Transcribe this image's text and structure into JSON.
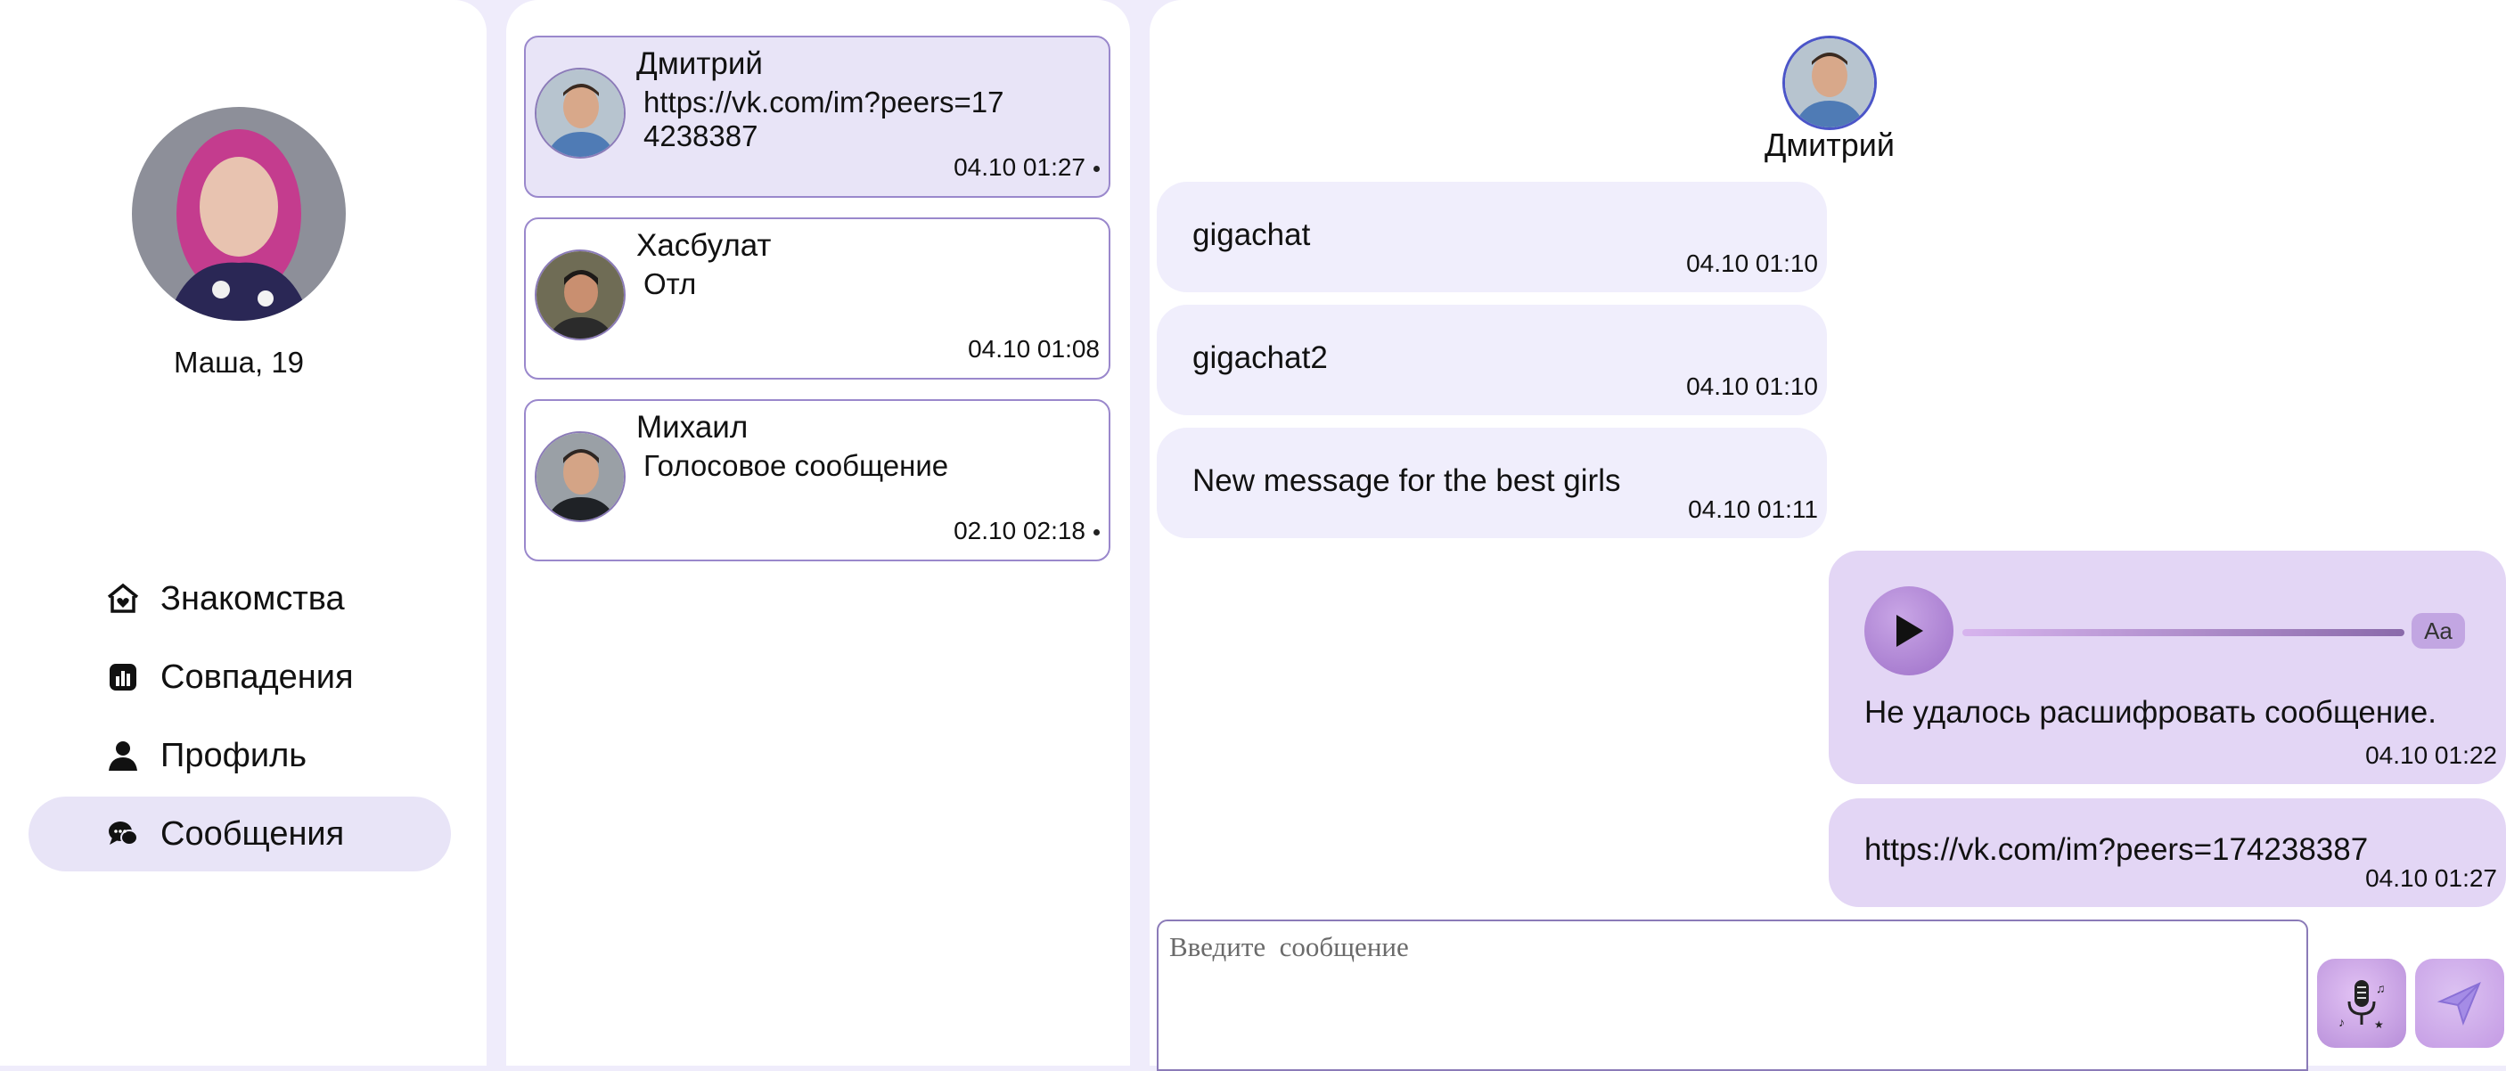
{
  "profile": {
    "name": "Маша, 19"
  },
  "nav": {
    "items": [
      {
        "label": "Знакомства",
        "icon": "home-heart-icon"
      },
      {
        "label": "Совпадения",
        "icon": "stats-icon"
      },
      {
        "label": "Профиль",
        "icon": "user-icon"
      },
      {
        "label": "Сообщения",
        "icon": "chat-icon",
        "active": true
      }
    ]
  },
  "conversations": [
    {
      "name": "Дмитрий",
      "text": "https://vk.com/im?peers=174238387",
      "time": "04.10 01:27",
      "unread": true,
      "active": true
    },
    {
      "name": "Хасбулат",
      "text": "Отл",
      "time": "04.10 01:08",
      "unread": false
    },
    {
      "name": "Михаил",
      "text": "Голосовое сообщение",
      "time": "02.10 02:18",
      "unread": true
    }
  ],
  "chat": {
    "peer_name": "Дмитрий",
    "messages": [
      {
        "direction": "in",
        "text": "gigachat",
        "time": "04.10 01:10"
      },
      {
        "direction": "in",
        "text": "gigachat2",
        "time": "04.10 01:10"
      },
      {
        "direction": "in",
        "text": "New message for the best girls",
        "time": "04.10 01:11"
      },
      {
        "direction": "out",
        "type": "voice",
        "text": "Не удалось расшифровать сообщение.",
        "time": "04.10 01:22",
        "aa_label": "Aa"
      },
      {
        "direction": "out",
        "text": "https://vk.com/im?peers=174238387",
        "time": "04.10 01:27"
      }
    ],
    "composer": {
      "placeholder": "Введите  сообщение"
    }
  },
  "colors": {
    "background": "#efecfb",
    "active": "#e8e4f7",
    "bubble_in": "#f0eefc",
    "bubble_out": "#e3d6f5",
    "accent": "#9a88cc"
  }
}
